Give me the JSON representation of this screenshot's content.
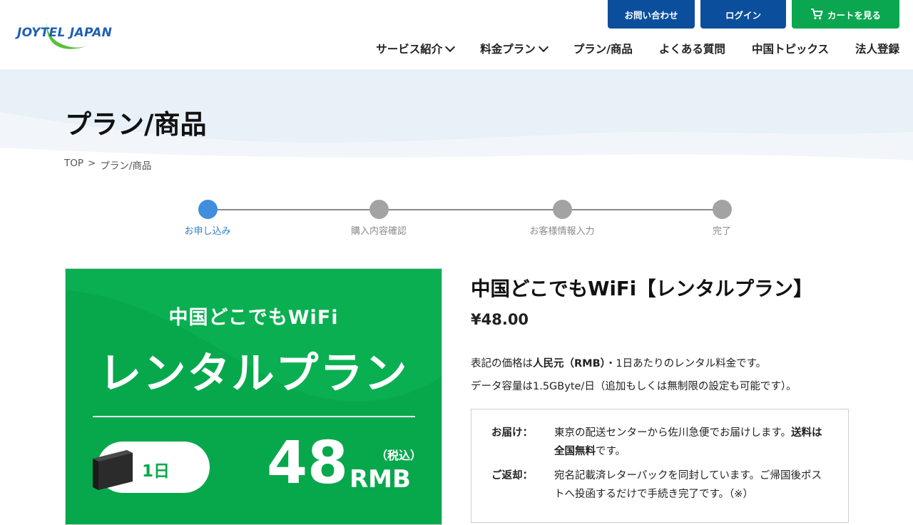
{
  "header": {
    "logo_text": "JOYTEL JAPAN",
    "buttons": {
      "contact": "お問い合わせ",
      "login": "ログイン",
      "cart": "カートを見る"
    },
    "nav": [
      {
        "label": "サービス紹介",
        "has_dropdown": true
      },
      {
        "label": "料金プラン",
        "has_dropdown": true
      },
      {
        "label": "プラン/商品",
        "has_dropdown": false
      },
      {
        "label": "よくある質問",
        "has_dropdown": false
      },
      {
        "label": "中国トピックス",
        "has_dropdown": false
      },
      {
        "label": "法人登録",
        "has_dropdown": false
      }
    ]
  },
  "page_title": "プラン/商品",
  "breadcrumb": {
    "home": "TOP",
    "separator": ">",
    "current": "プラン/商品"
  },
  "steps": [
    {
      "label": "お申し込み",
      "active": true
    },
    {
      "label": "購入内容確認",
      "active": false
    },
    {
      "label": "お客様情報入力",
      "active": false
    },
    {
      "label": "完了",
      "active": false
    }
  ],
  "product_image": {
    "subtitle": "中国どこでもWiFi",
    "title": "レンタルプラン",
    "days": "1日",
    "price": "48",
    "unit": "RMB",
    "tax_note": "（税込）"
  },
  "product": {
    "title": "中国どこでもWiFi【レンタルプラン】",
    "price": "¥48.00",
    "desc1_pre": "表記の価格は",
    "desc1_bold": "人民元（RMB）",
    "desc1_post": "・1日あたりのレンタル料金です。",
    "desc2": "データ容量は1.5GByte/日（追加もしくは無制限の設定も可能です）。",
    "info": [
      {
        "key": "お届け：",
        "val_pre": "東京の配送センターから佐川急便でお届けします。",
        "val_bold": "送料は全国無料",
        "val_post": "です。"
      },
      {
        "key": "ご返却：",
        "val_pre": "宛名記載済レターパックを同封しています。ご帰国後ポストへ投函するだけで手続き完了です。（※）",
        "val_bold": "",
        "val_post": ""
      }
    ]
  },
  "colors": {
    "brand_blue": "#0b4f9c",
    "cart_green": "#0aa650",
    "step_active": "#3f8fdc",
    "product_green": "#07a84c"
  }
}
